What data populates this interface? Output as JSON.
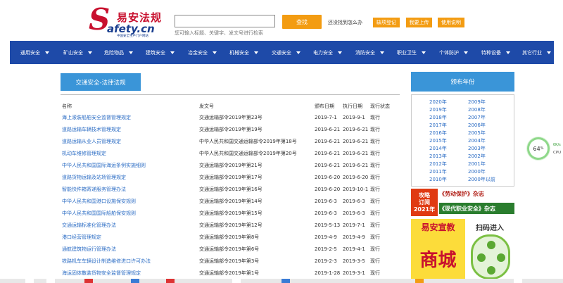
{
  "header": {
    "logo_s": "S",
    "logo_cn": "易安法规",
    "logo_url": "afety.cn",
    "logo_slogan": "中国安全生产门户网站",
    "search_placeholder": "",
    "search_hint": "您可输入标题、关键字、发文号进行检索",
    "search_button": "查找",
    "not_found_text": "还没找到怎么办",
    "buttons": [
      "缺项登记",
      "我要上传",
      "使用说明"
    ]
  },
  "nav": {
    "items": [
      "通用安全",
      "矿山安全",
      "危险物品",
      "建筑安全",
      "冶金安全",
      "机械安全",
      "交通安全",
      "电力安全",
      "消防安全",
      "职业卫生",
      "个体防护",
      "特种设备",
      "其它行业"
    ]
  },
  "section": {
    "title": "交通安全-法律法规",
    "headers": [
      "名称",
      "发文号",
      "颁布日期",
      "执行日期",
      "现行状态"
    ],
    "rows": [
      {
        "name": "海上滚装船舶安全监督管理规定",
        "doc": "交通运输部令2019年第23号",
        "pub": "2019-7-1",
        "exe": "2019-9-1",
        "status": "现行"
      },
      {
        "name": "道路运输车辆技术管理规定",
        "doc": "交通运输部令2019年第19号",
        "pub": "2019-6-21",
        "exe": "2019-6-21",
        "status": "现行"
      },
      {
        "name": "道路运输从业人员管理规定",
        "doc": "中华人民共和国交通运输部令2019年第18号",
        "pub": "2019-6-21",
        "exe": "2019-6-21",
        "status": "现行"
      },
      {
        "name": "机动车维修管理规定",
        "doc": "中华人民共和国交通运输部令2019年第20号",
        "pub": "2019-6-21",
        "exe": "2019-6-21",
        "status": "现行"
      },
      {
        "name": "中华人民共和国国际海运条例实施细则",
        "doc": "交通运输部令2019年第21号",
        "pub": "2019-6-21",
        "exe": "2019-6-21",
        "status": "现行"
      },
      {
        "name": "道路货物运输及站场管理规定",
        "doc": "交通运输部令2019年第17号",
        "pub": "2019-6-20",
        "exe": "2019-6-20",
        "status": "现行"
      },
      {
        "name": "智能快件箱寄递服务管理办法",
        "doc": "交通运输部令2019年第16号",
        "pub": "2019-6-20",
        "exe": "2019-10-1",
        "status": "现行"
      },
      {
        "name": "中华人民共和国港口设施保安规则",
        "doc": "交通运输部令2019年第14号",
        "pub": "2019-6-3",
        "exe": "2019-6-3",
        "status": "现行"
      },
      {
        "name": "中华人民共和国国际船舶保安规则",
        "doc": "交通运输部令2019年第15号",
        "pub": "2019-6-3",
        "exe": "2019-6-3",
        "status": "现行"
      },
      {
        "name": "交通运输标准化管理办法",
        "doc": "交通运输部令2019年第12号",
        "pub": "2019-5-13",
        "exe": "2019-7-1",
        "status": "现行"
      },
      {
        "name": "港口经营管理规定",
        "doc": "交通运输部令2019年第8号",
        "pub": "2019-4-9",
        "exe": "2019-4-9",
        "status": "现行"
      },
      {
        "name": "通航建筑物运行管理办法",
        "doc": "交通运输部令2019年第6号",
        "pub": "2019-2-5",
        "exe": "2019-4-1",
        "status": "现行"
      },
      {
        "name": "铁路机车车辆设计制造维修进口许可办法",
        "doc": "交通运输部令2019年第3号",
        "pub": "2019-2-3",
        "exe": "2019-3-5",
        "status": "现行"
      },
      {
        "name": "海运固体散装货物安全监督管理规定",
        "doc": "交通运输部令2019年第1号",
        "pub": "2019-1-28",
        "exe": "2019-3-1",
        "status": "现行"
      }
    ]
  },
  "years": {
    "title": "颁布年份",
    "col1": [
      "2020年",
      "2019年",
      "2018年",
      "2017年",
      "2016年",
      "2015年",
      "2014年",
      "2013年",
      "2012年",
      "2011年",
      "2010年"
    ],
    "col2": [
      "2009年",
      "2008年",
      "2007年",
      "2006年",
      "2005年",
      "2004年",
      "2003年",
      "2002年",
      "2001年",
      "2000年",
      "2000年以前"
    ]
  },
  "ads": {
    "ad1_left": [
      "攻略",
      "订阅",
      "2021年"
    ],
    "ad1_line1": "《劳动保护》杂志",
    "ad1_line2": "《现代职业安全》杂志",
    "ad2_line1": "易安宣教",
    "ad2_line2": "商城",
    "ad3_line1": "扫码进入"
  },
  "widget": {
    "value": "64",
    "unit": "%",
    "cpu": "CPU",
    "top": "0K/s"
  },
  "colors": {
    "nav_bg": "#1e4aa8",
    "accent_blue": "#3a95d8",
    "orange": "#f39c12",
    "link": "#2b6cc4",
    "logo_red": "#c8102e"
  }
}
